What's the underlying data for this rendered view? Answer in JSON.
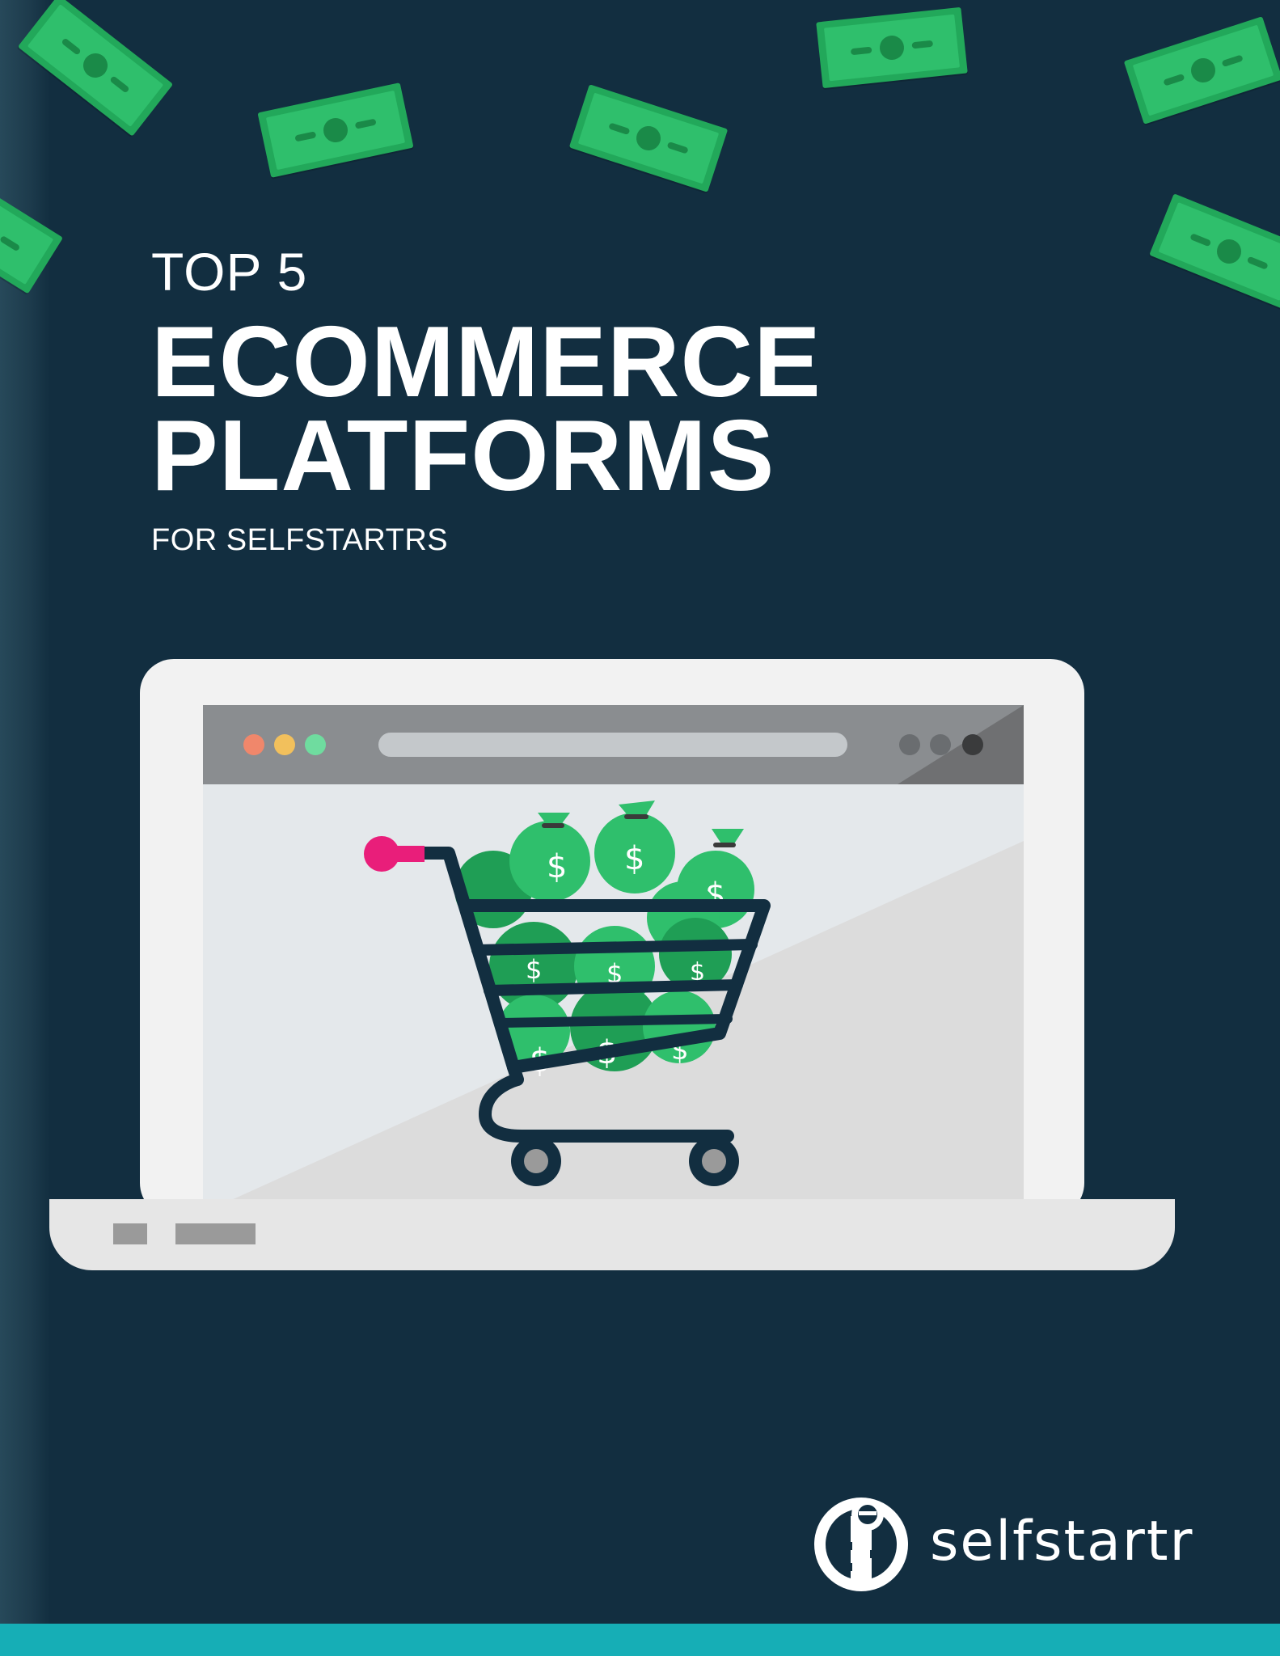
{
  "cover": {
    "eyebrow": "TOP 5",
    "title_line1": "ECOMMERCE",
    "title_line2": "PLATFORMS",
    "subtitle": "FOR SELFSTARTRS"
  },
  "brand": {
    "name": "selfstartr",
    "logo_icon": "key-in-circle-logo"
  },
  "colors": {
    "background": "#122e40",
    "money_green": "#2fbf6c",
    "accent_pink": "#e91e7a",
    "bottom_bar": "#16aeb6"
  },
  "illustration": {
    "subject": "laptop-icon",
    "browser_dots": [
      "#f0876b",
      "#f2c05c",
      "#6fdc9f"
    ],
    "cart": "shopping-cart-icon",
    "money_bag": "money-bag-icon",
    "bag_symbol": "$"
  }
}
